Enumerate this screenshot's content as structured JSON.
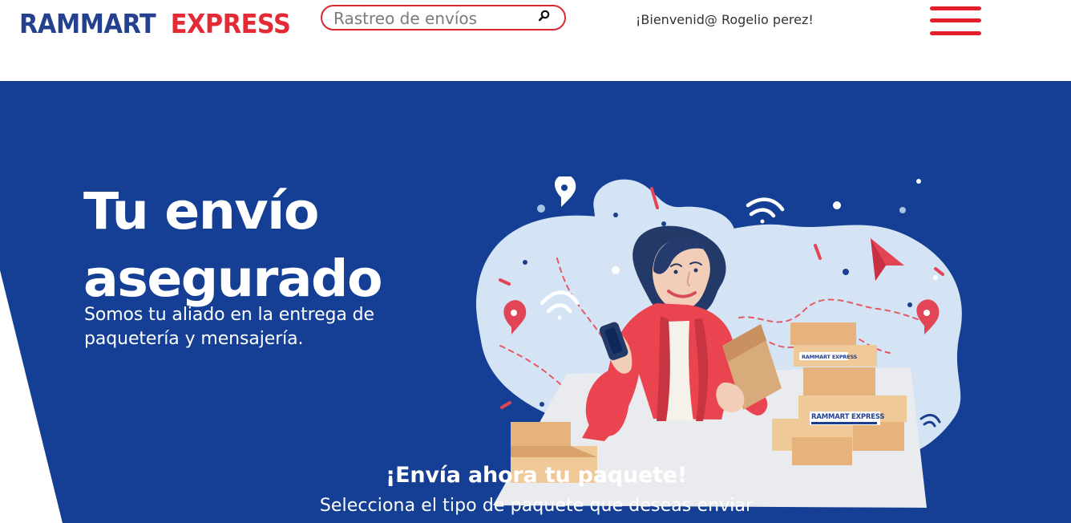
{
  "header": {
    "logo": {
      "part_one": "RAMMART",
      "part_two": "EXPRESS"
    },
    "search": {
      "placeholder": "Rastreo de envíos",
      "icon": "search-icon"
    },
    "welcome_text": "¡Bienvenid@ Rogelio perez!",
    "menu_icon": "hamburger-menu-icon"
  },
  "hero": {
    "title": "Tu envío asegurado",
    "subtitle": "Somos tu aliado en la entrega de paquetería y mensajería.",
    "illustration": {
      "box_label_one": "RAMMART EXPRESS",
      "box_label_two": "RAMMART EXPRESS"
    }
  },
  "cta": {
    "title": "¡Envía ahora tu paquete!",
    "subtitle": "Selecciona el tipo de paquete que deseas enviar"
  },
  "colors": {
    "header_background": "#ffffff",
    "brand_blue": "#24418f",
    "brand_red": "#e32a35",
    "hero_blue": "#143f94",
    "art_blob": "#d4e4f4",
    "box_tan": "#f0c998"
  }
}
